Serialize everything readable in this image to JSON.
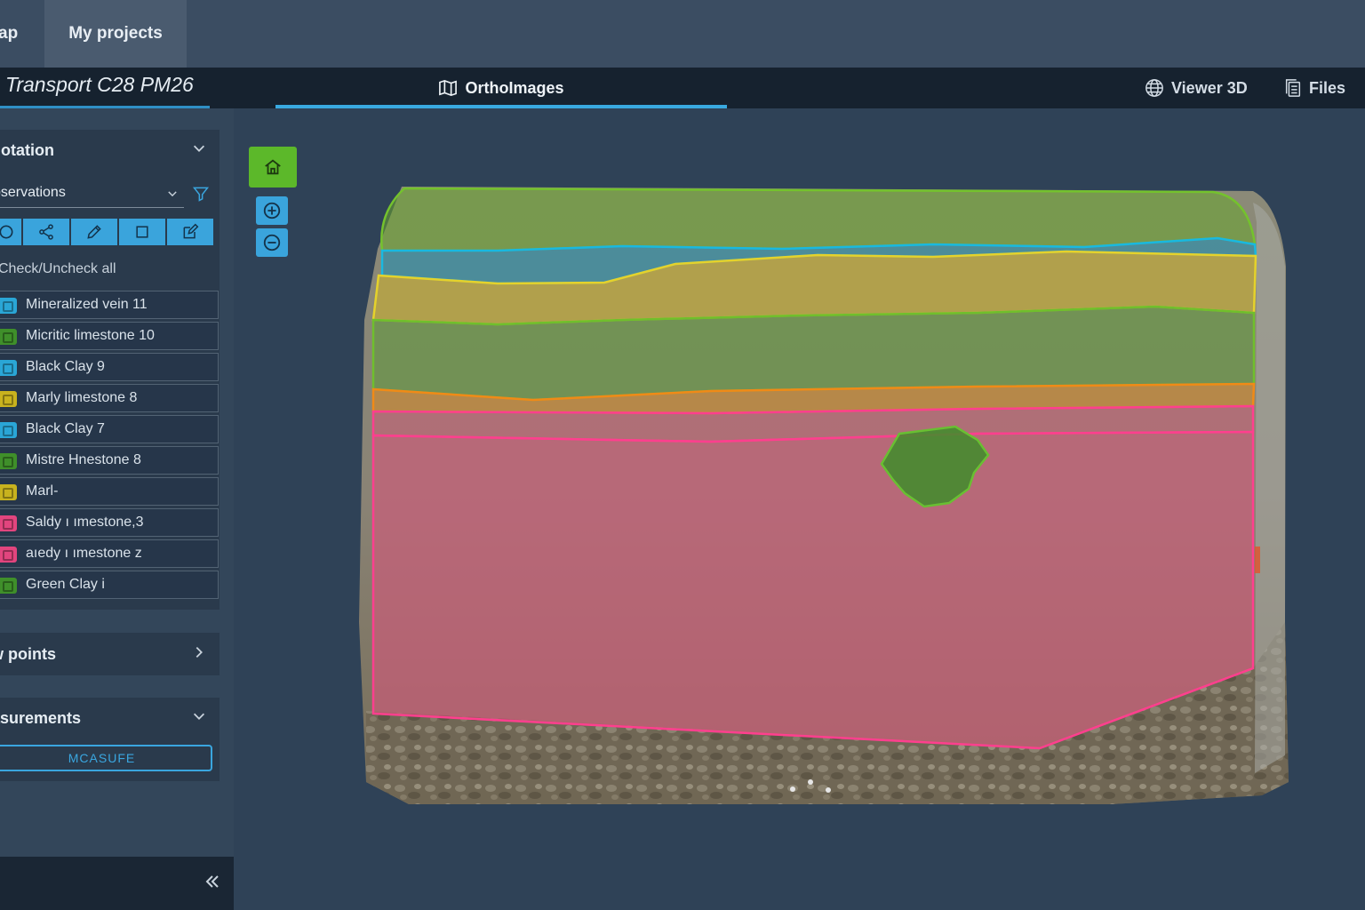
{
  "nav": {
    "map_label": "ap",
    "projects_label": "My projects"
  },
  "project": {
    "title": "Transport C28 PM26"
  },
  "tabs": {
    "ortho": "OrthoImages",
    "viewer": "Viewer 3D",
    "files": "Files"
  },
  "annotation_panel": {
    "title": "notation",
    "select_value": "bservations",
    "check_all": "Check/Uncheck all",
    "layers": [
      {
        "name": "Mineralized vein 11",
        "color": "#2aa6d6"
      },
      {
        "name": "Micritic limestone 10",
        "color": "#3f8f2a"
      },
      {
        "name": "Black Clay 9",
        "color": "#2aa6d6"
      },
      {
        "name": "Marly limestone 8",
        "color": "#c8b21e"
      },
      {
        "name": "Black Clay 7",
        "color": "#2aa6d6"
      },
      {
        "name": "Mistre Hnestone 8",
        "color": "#3f8f2a"
      },
      {
        "name": "Marl-",
        "color": "#c8b21e"
      },
      {
        "name": "Saldy ı ımestone,3",
        "color": "#e2457e"
      },
      {
        "name": "aıedy ı ımestone z",
        "color": "#e2457e"
      },
      {
        "name": "Green Clay i",
        "color": "#3f8f2a"
      }
    ]
  },
  "view_points_panel": {
    "title": "w points"
  },
  "measurements_panel": {
    "title": "asurements",
    "measure_label": "MCASUFE"
  },
  "colors": {
    "accent": "#3aa6df",
    "home": "#5cb82a",
    "green_layer": "#6aa52e",
    "cyan_layer": "#19b8e0",
    "yellow_layer": "#e5d22b",
    "orange_layer": "#f08a17",
    "pink_layer": "#ff3f8e"
  }
}
